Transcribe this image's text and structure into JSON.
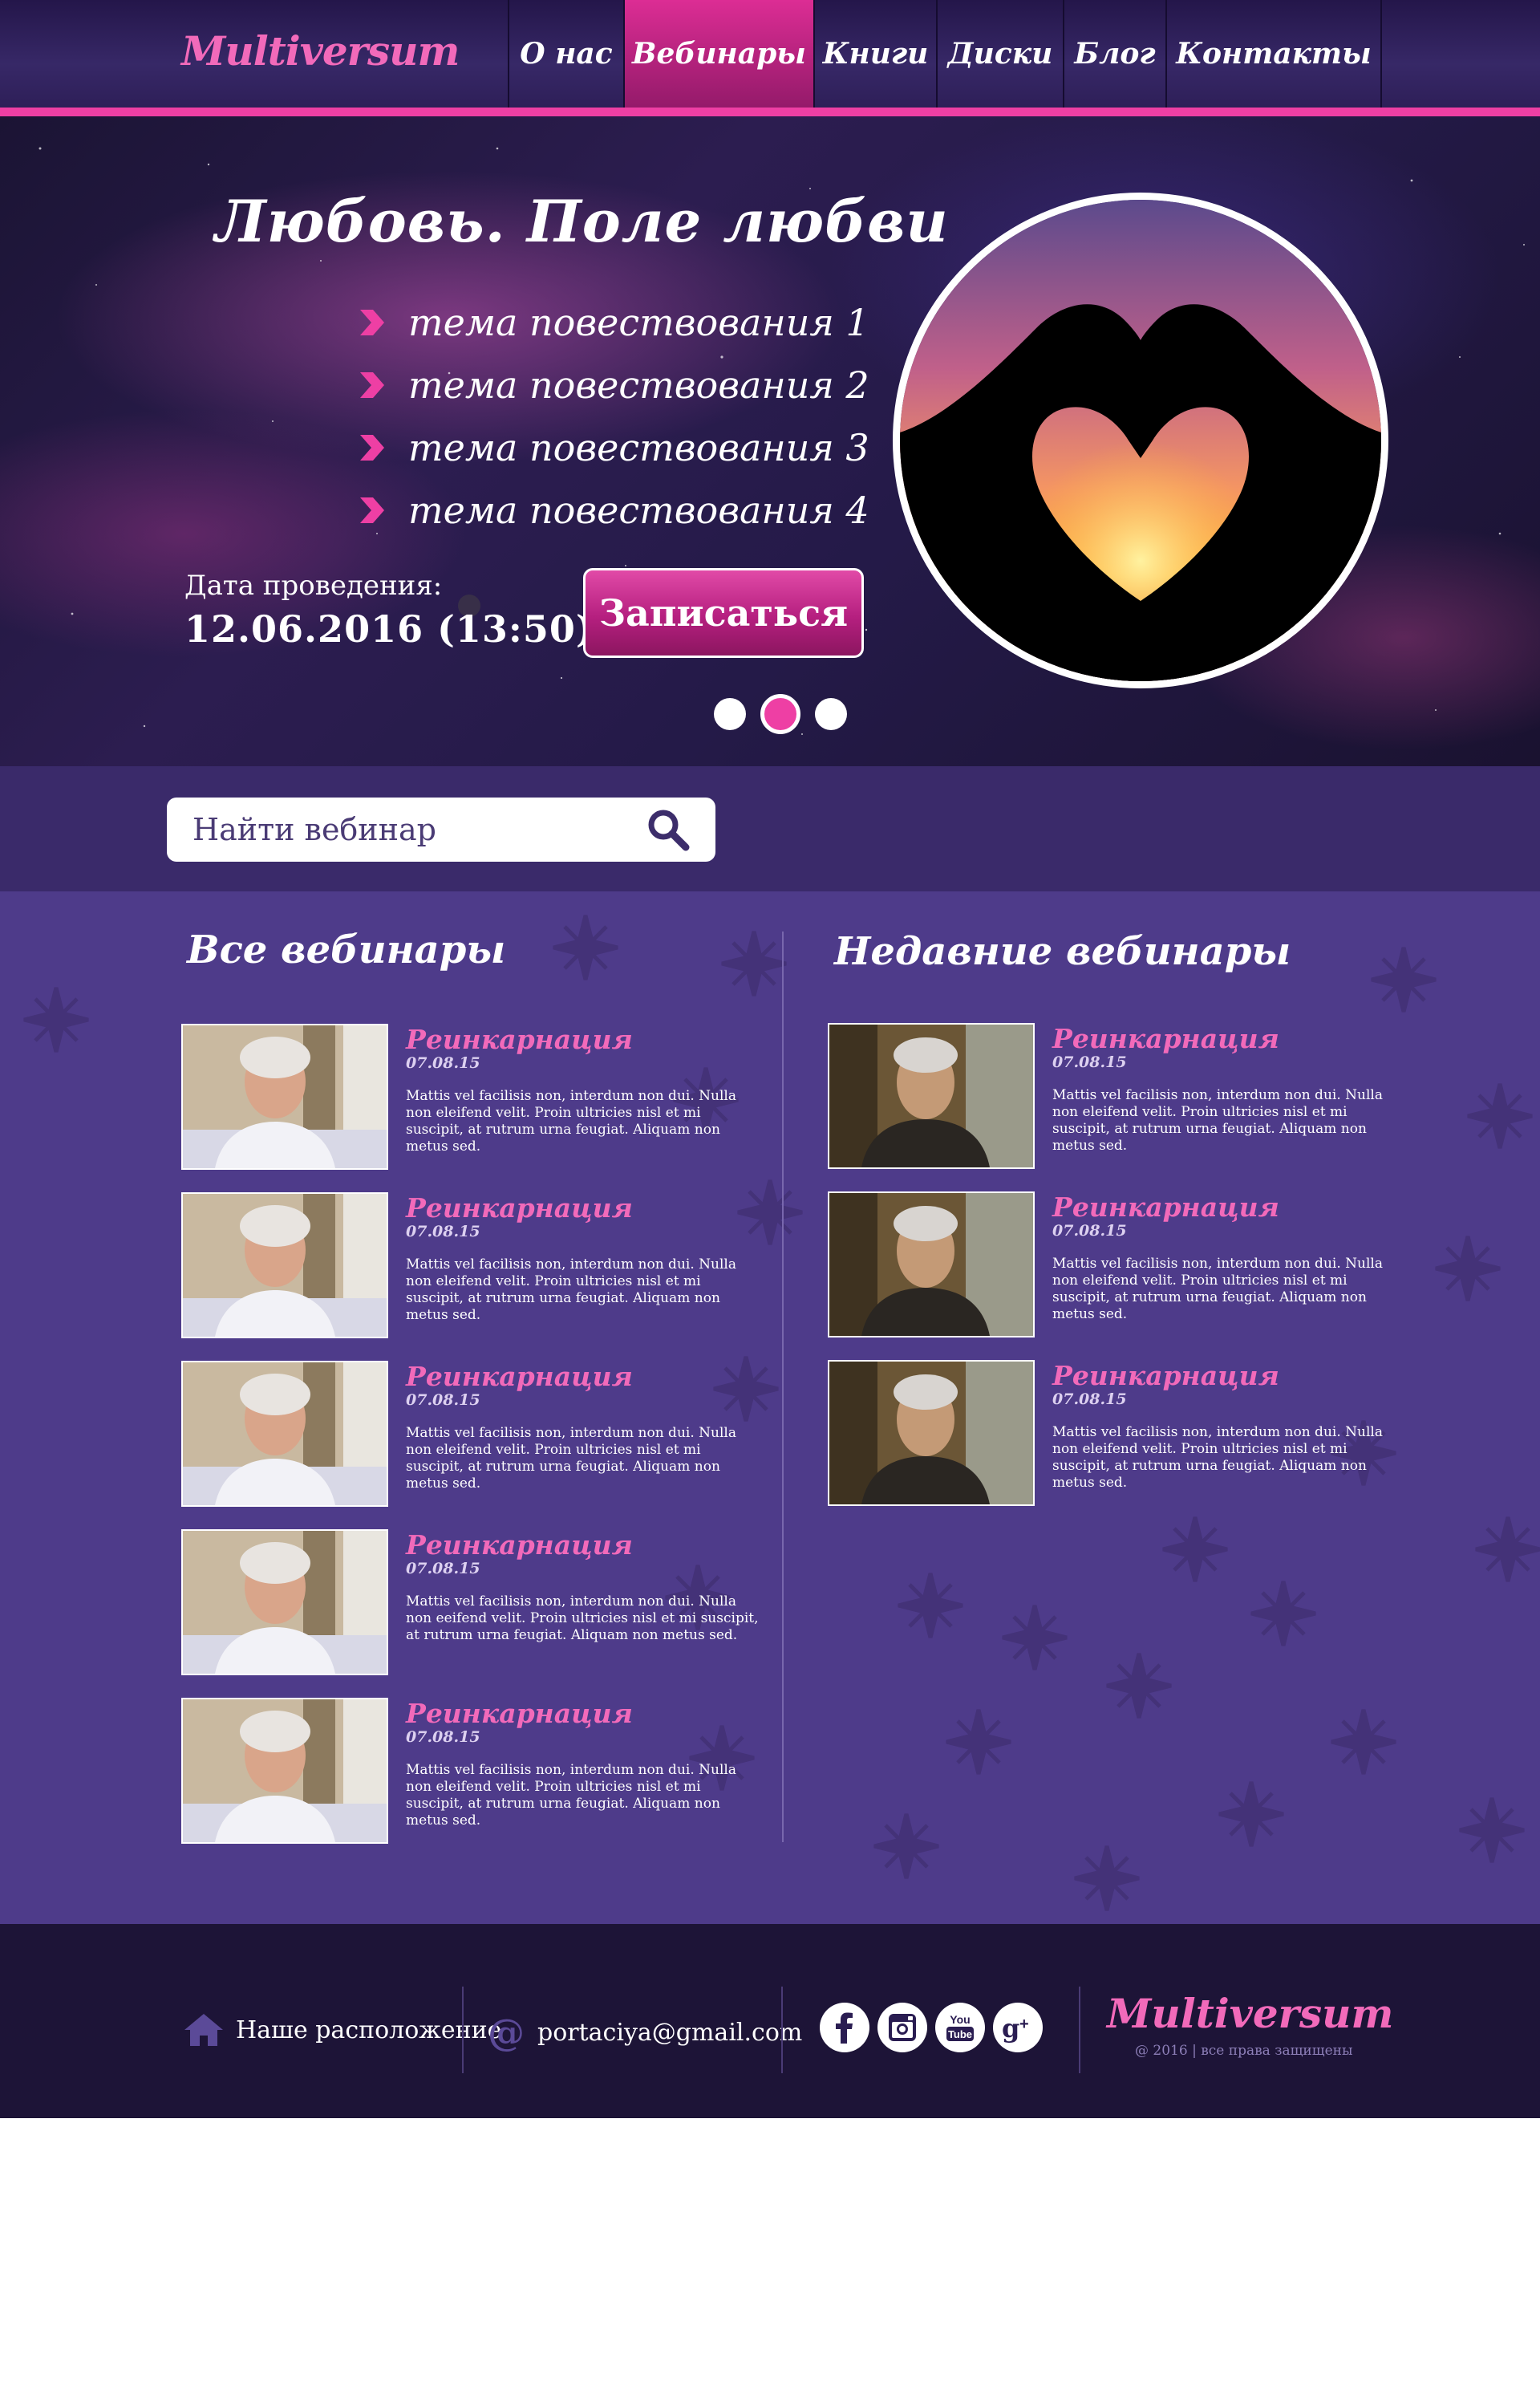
{
  "header": {
    "logo": "Multiversum",
    "nav": [
      {
        "label": "О нас",
        "active": false
      },
      {
        "label": "Вебинары",
        "active": true
      },
      {
        "label": "Книги",
        "active": false
      },
      {
        "label": "Диски",
        "active": false
      },
      {
        "label": "Блог",
        "active": false
      },
      {
        "label": "Контакты",
        "active": false
      }
    ]
  },
  "hero": {
    "title": "Любовь. Поле любви",
    "topics": [
      "тема повествования 1",
      "тема повествования 2",
      "тема повествования 3",
      "тема повествования 4"
    ],
    "date_label": "Дата проведения:",
    "date_value": "12.06.2016 (13:50)",
    "signup_label": "Записаться",
    "slides": {
      "count": 3,
      "active": 2
    }
  },
  "search": {
    "placeholder": "Найти вебинар"
  },
  "all_webinars": {
    "title": "Все вебинары",
    "items": [
      {
        "title": "Реинкарнация",
        "date": "07.08.15",
        "text": "Mattis vel facilisis non, interdum non dui. Nulla non eleifend velit. Proin ultricies nisl et mi suscipit, at rutrum urna feugiat. Aliquam non metus sed."
      },
      {
        "title": "Реинкарнация",
        "date": "07.08.15",
        "text": "Mattis vel facilisis non, interdum non dui. Nulla non eleifend velit. Proin ultricies nisl et mi suscipit, at rutrum urna feugiat. Aliquam non metus sed."
      },
      {
        "title": "Реинкарнация",
        "date": "07.08.15",
        "text": "Mattis vel facilisis non, interdum non dui. Nulla non eleifend velit. Proin ultricies nisl et mi suscipit, at rutrum urna feugiat. Aliquam non metus sed."
      },
      {
        "title": "Реинкарнация",
        "date": "07.08.15",
        "text": "Mattis vel facilisis non, interdum non dui. Nulla non eeifend velit. Proin ultricies nisl et mi suscipit, at rutrum urna feugiat. Aliquam non metus sed."
      },
      {
        "title": "Реинкарнация",
        "date": "07.08.15",
        "text": "Mattis vel facilisis non, interdum non dui. Nulla non eleifend velit. Proin ultricies nisl et mi suscipit, at rutrum urna feugiat. Aliquam non metus sed."
      }
    ]
  },
  "recent_webinars": {
    "title": "Недавние вебинары",
    "items": [
      {
        "title": "Реинкарнация",
        "date": "07.08.15",
        "text": "Mattis vel facilisis non, interdum non dui. Nulla non eleifend velit. Proin ultricies nisl et mi suscipit, at rutrum urna feugiat. Aliquam non metus sed."
      },
      {
        "title": "Реинкарнация",
        "date": "07.08.15",
        "text": "Mattis vel facilisis non, interdum non dui. Nulla non eleifend velit. Proin ultricies nisl et mi suscipit, at rutrum urna feugiat. Aliquam non metus sed."
      },
      {
        "title": "Реинкарнация",
        "date": "07.08.15",
        "text": "Mattis vel facilisis non, interdum non dui. Nulla non eleifend velit. Proin ultricies nisl et mi suscipit, at rutrum urna feugiat. Aliquam non metus sed."
      }
    ]
  },
  "footer": {
    "location_label": "Наше расположение",
    "email": "portaciya@gmail.com",
    "social": [
      "facebook-icon",
      "instagram-icon",
      "youtube-icon",
      "google-plus-icon"
    ],
    "logo": "Multiversum",
    "copyright": "@ 2016 | все права защищены"
  },
  "colors": {
    "accent": "#ee3fa4",
    "brand_pink": "#f26aba",
    "header_bg": "#2c1d55",
    "main_bg": "#4e3b8a",
    "footer_bg": "#1d1437"
  }
}
